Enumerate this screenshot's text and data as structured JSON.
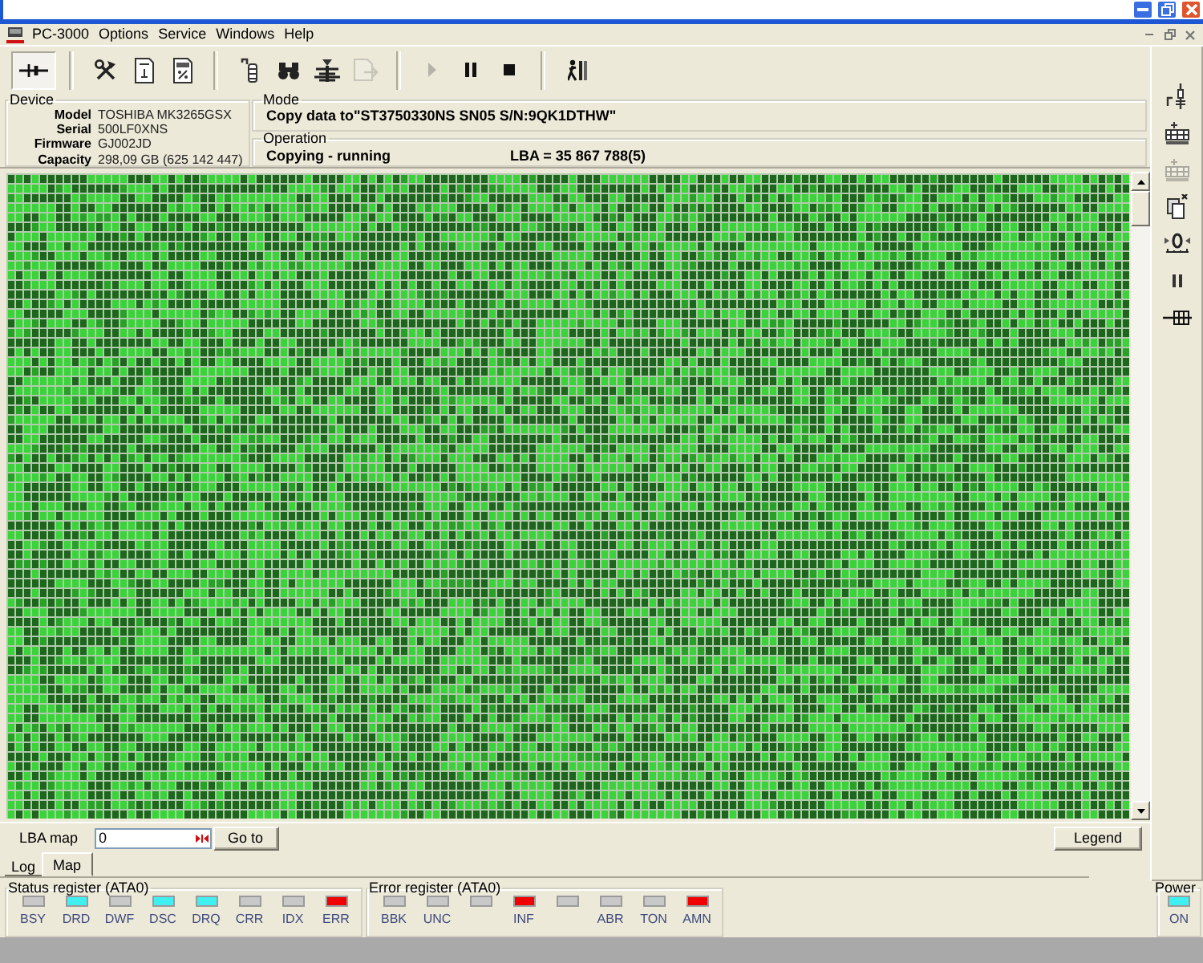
{
  "menu": [
    "PC-3000",
    "Options",
    "Service",
    "Windows",
    "Help"
  ],
  "toolbar": {
    "groups": [
      [
        {
          "pressed": true,
          "disabled": false
        }
      ],
      [
        {
          "pressed": false,
          "disabled": false
        },
        {
          "pressed": false,
          "disabled": false
        },
        {
          "pressed": false,
          "disabled": false
        }
      ],
      [
        {
          "pressed": false,
          "disabled": false
        },
        {
          "pressed": false,
          "disabled": false
        },
        {
          "pressed": false,
          "disabled": false
        },
        {
          "pressed": false,
          "disabled": true
        }
      ],
      [
        {
          "pressed": false,
          "disabled": true
        },
        {
          "pressed": false,
          "disabled": false
        },
        {
          "pressed": false,
          "disabled": false
        }
      ],
      [
        {
          "pressed": false,
          "disabled": false
        }
      ]
    ]
  },
  "device": {
    "title": "Device",
    "fields": [
      {
        "label": "Model",
        "value": "TOSHIBA MK3265GSX"
      },
      {
        "label": "Serial",
        "value": "500LF0XNS"
      },
      {
        "label": "Firmware",
        "value": "GJ002JD"
      },
      {
        "label": "Capacity",
        "value": "298,09 GB (625 142 447)"
      }
    ]
  },
  "mode": {
    "title": "Mode",
    "text": "Copy data to\"ST3750330NS SN05 S/N:9QK1DTHW\""
  },
  "operation": {
    "title": "Operation",
    "status": "Copying - running",
    "lba": "LBA = 35 867 788(5)"
  },
  "lba_map": {
    "label": "LBA map",
    "value": "0",
    "goto": "Go to",
    "legend": "Legend"
  },
  "tabs": [
    {
      "label": "Log",
      "selected": false
    },
    {
      "label": "Map",
      "selected": true
    }
  ],
  "side_toolbar": [
    {
      "disabled": false
    },
    {
      "disabled": false
    },
    {
      "disabled": true
    },
    {
      "disabled": false
    },
    {
      "disabled": false
    },
    {
      "disabled": false
    },
    {
      "disabled": false
    }
  ],
  "status_register": {
    "title": "Status register (ATA0)",
    "flags": [
      {
        "label": "BSY",
        "color": "#c8c8c8"
      },
      {
        "label": "DRD",
        "color": "#40f0f0"
      },
      {
        "label": "DWF",
        "color": "#c8c8c8"
      },
      {
        "label": "DSC",
        "color": "#40f0f0"
      },
      {
        "label": "DRQ",
        "color": "#40f0f0"
      },
      {
        "label": "CRR",
        "color": "#c8c8c8"
      },
      {
        "label": "IDX",
        "color": "#c8c8c8"
      },
      {
        "label": "ERR",
        "color": "#f00000"
      }
    ]
  },
  "error_register": {
    "title": "Error register (ATA0)",
    "flags": [
      {
        "label": "BBK",
        "color": "#c8c8c8"
      },
      {
        "label": "UNC",
        "color": "#c8c8c8"
      },
      {
        "color": "#c8c8c8"
      },
      {
        "label": "INF",
        "color": "#f00000"
      },
      {
        "color": "#c8c8c8"
      },
      {
        "label": "ABR",
        "color": "#c8c8c8"
      },
      {
        "label": "TON",
        "color": "#c8c8c8"
      },
      {
        "label": "AMN",
        "color": "#f00000"
      }
    ]
  },
  "power": {
    "title": "Power",
    "flags": [
      {
        "label": "ON",
        "color": "#40f0f0"
      }
    ]
  }
}
